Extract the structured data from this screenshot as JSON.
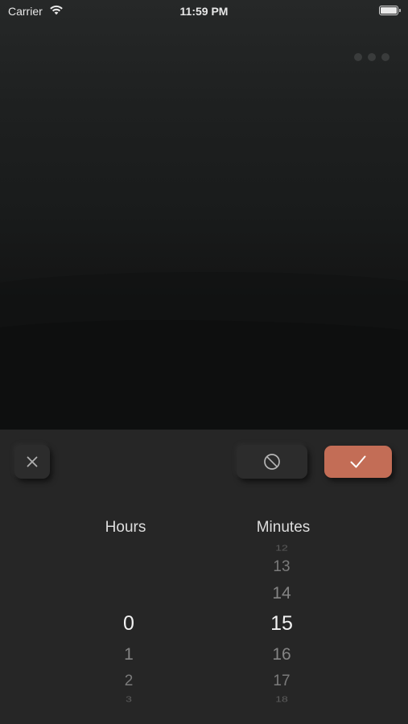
{
  "status_bar": {
    "carrier": "Carrier",
    "time": "11:59 PM",
    "wifi_icon": "wifi-icon",
    "battery_icon": "battery-icon"
  },
  "toolbar": {
    "more_icon": "ellipsis-icon",
    "cancel_icon": "close-icon",
    "clear_icon": "prohibited-icon",
    "confirm_icon": "checkmark-icon",
    "confirm_color": "#c36d56"
  },
  "picker": {
    "hours_label": "Hours",
    "minutes_label": "Minutes",
    "hours": {
      "values": [
        "0",
        "1",
        "2",
        "3"
      ],
      "selected": "0"
    },
    "minutes": {
      "values": [
        "12",
        "13",
        "14",
        "15",
        "16",
        "17",
        "18"
      ],
      "selected": "15"
    }
  },
  "colors": {
    "sheet_background": "#262626",
    "selected_text": "#f2f2f2",
    "unselected_text": "#8a8a8a"
  }
}
